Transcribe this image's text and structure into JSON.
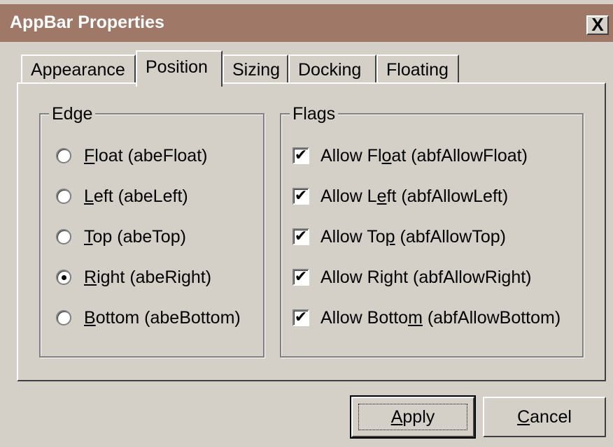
{
  "window": {
    "title": "AppBar Properties",
    "close_label": "X"
  },
  "tabs": [
    {
      "label": "Appearance",
      "active": false
    },
    {
      "label": "Position",
      "active": true
    },
    {
      "label": "Sizing",
      "active": false
    },
    {
      "label": "Docking",
      "active": false
    },
    {
      "label": "Floating",
      "active": false
    }
  ],
  "edge_group": {
    "label": "Edge",
    "options": [
      {
        "mnemonic": "F",
        "rest": "loat (abeFloat)",
        "checked": false
      },
      {
        "mnemonic": "L",
        "rest": "eft (abeLeft)",
        "checked": false
      },
      {
        "mnemonic": "T",
        "rest": "op (abeTop)",
        "checked": false
      },
      {
        "mnemonic": "R",
        "rest": "ight (abeRight)",
        "checked": true
      },
      {
        "mnemonic": "B",
        "rest": "ottom (abeBottom)",
        "checked": false
      }
    ]
  },
  "flags_group": {
    "label": "Flags",
    "options": [
      {
        "pre": "Allow Fl",
        "mnemonic": "o",
        "post": "at (abfAllowFloat)",
        "checked": true
      },
      {
        "pre": "Allow L",
        "mnemonic": "e",
        "post": "ft (abfAllowLeft)",
        "checked": true
      },
      {
        "pre": "Allow To",
        "mnemonic": "p",
        "post": " (abfAllowTop)",
        "checked": true
      },
      {
        "pre": "Allow Ri",
        "mnemonic": "g",
        "post": "ht (abfAllowRight)",
        "checked": true
      },
      {
        "pre": "Allow Botto",
        "mnemonic": "m",
        "post": " (abfAllowBottom)",
        "checked": true
      }
    ],
    "check_mark": "✔"
  },
  "buttons": {
    "apply": {
      "mnemonic": "A",
      "rest": "pply"
    },
    "cancel": {
      "mnemonic": "C",
      "rest": "ancel"
    }
  }
}
